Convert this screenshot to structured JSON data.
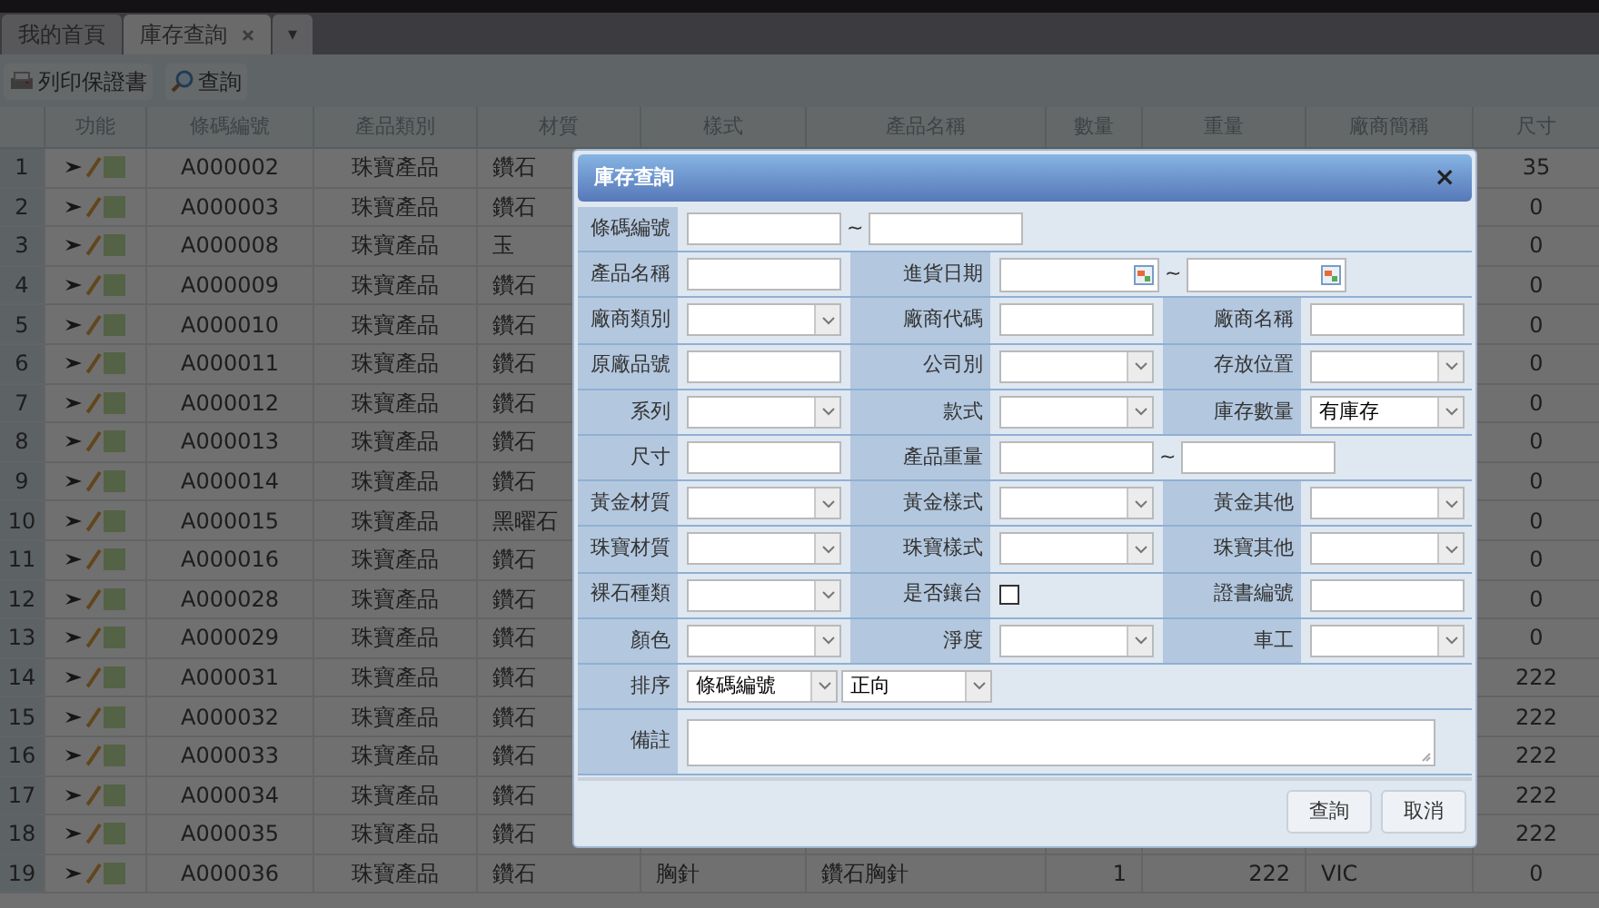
{
  "tabs": [
    {
      "label": "我的首頁",
      "selected": false,
      "closable": false
    },
    {
      "label": "庫存查詢",
      "selected": true,
      "closable": true
    }
  ],
  "tab_menu": "▾",
  "toolbar": [
    {
      "label": "列印保證書",
      "kind": "print"
    },
    {
      "label": "查詢",
      "kind": "search"
    }
  ],
  "table": {
    "columns": [
      "功能",
      "條碼編號",
      "產品類別",
      "材質",
      "樣式",
      "產品名稱",
      "數量",
      "重量",
      "廠商簡稱",
      "尺寸"
    ],
    "rows": [
      {
        "number": "1",
        "barcode": "A000002",
        "category": "珠寶產品",
        "material": "鑽石",
        "size": "35"
      },
      {
        "number": "2",
        "barcode": "A000003",
        "category": "珠寶產品",
        "material": "鑽石",
        "size": "0"
      },
      {
        "number": "3",
        "barcode": "A000008",
        "category": "珠寶產品",
        "material": "玉",
        "size": "0"
      },
      {
        "number": "4",
        "barcode": "A000009",
        "category": "珠寶產品",
        "material": "鑽石",
        "size": "0"
      },
      {
        "number": "5",
        "barcode": "A000010",
        "category": "珠寶產品",
        "material": "鑽石",
        "size": "0"
      },
      {
        "number": "6",
        "barcode": "A000011",
        "category": "珠寶產品",
        "material": "鑽石",
        "size": "0"
      },
      {
        "number": "7",
        "barcode": "A000012",
        "category": "珠寶產品",
        "material": "鑽石",
        "size": "0"
      },
      {
        "number": "8",
        "barcode": "A000013",
        "category": "珠寶產品",
        "material": "鑽石",
        "size": "0"
      },
      {
        "number": "9",
        "barcode": "A000014",
        "category": "珠寶產品",
        "material": "鑽石",
        "size": "0"
      },
      {
        "number": "10",
        "barcode": "A000015",
        "category": "珠寶產品",
        "material": "黑曜石",
        "size": "0"
      },
      {
        "number": "11",
        "barcode": "A000016",
        "category": "珠寶產品",
        "material": "鑽石",
        "size": "0"
      },
      {
        "number": "12",
        "barcode": "A000028",
        "category": "珠寶產品",
        "material": "鑽石",
        "size": "0"
      },
      {
        "number": "13",
        "barcode": "A000029",
        "category": "珠寶產品",
        "material": "鑽石",
        "size": "0"
      },
      {
        "number": "14",
        "barcode": "A000031",
        "category": "珠寶產品",
        "material": "鑽石",
        "size": "222"
      },
      {
        "number": "15",
        "barcode": "A000032",
        "category": "珠寶產品",
        "material": "鑽石",
        "size": "222"
      },
      {
        "number": "16",
        "barcode": "A000033",
        "category": "珠寶產品",
        "material": "鑽石",
        "size": "222"
      },
      {
        "number": "17",
        "barcode": "A000034",
        "category": "珠寶產品",
        "material": "鑽石",
        "size": "222"
      },
      {
        "number": "18",
        "barcode": "A000035",
        "category": "珠寶產品",
        "material": "鑽石",
        "size": "222"
      },
      {
        "number": "19",
        "barcode": "A000036",
        "category": "珠寶產品",
        "material": "鑽石",
        "style": "胸針",
        "name": "鑽石胸針",
        "quantity": "1",
        "weight": "222",
        "vendor": "VIC",
        "size": "0"
      }
    ]
  },
  "dialog": {
    "title": "庫存查詢",
    "close": "×",
    "rows": [
      [
        {
          "label": "條碼編號",
          "kind": "text-range",
          "separator": "~"
        }
      ],
      [
        {
          "label": "產品名稱",
          "kind": "text"
        },
        {
          "label": "進貨日期",
          "kind": "date-range",
          "separator": "~"
        }
      ],
      [
        {
          "label": "廠商類別",
          "kind": "select"
        },
        {
          "label": "廠商代碼",
          "kind": "text"
        },
        {
          "label": "廠商名稱",
          "kind": "text"
        }
      ],
      [
        {
          "label": "原廠品號",
          "kind": "text"
        },
        {
          "label": "公司別",
          "kind": "select"
        },
        {
          "label": "存放位置",
          "kind": "select"
        }
      ],
      [
        {
          "label": "系列",
          "kind": "select"
        },
        {
          "label": "款式",
          "kind": "select"
        },
        {
          "label": "庫存數量",
          "kind": "select",
          "value": "有庫存"
        }
      ],
      [
        {
          "label": "尺寸",
          "kind": "text"
        },
        {
          "label": "產品重量",
          "kind": "text-range",
          "separator": "~"
        }
      ],
      [
        {
          "label": "黃金材質",
          "kind": "select"
        },
        {
          "label": "黃金樣式",
          "kind": "select"
        },
        {
          "label": "黃金其他",
          "kind": "select"
        }
      ],
      [
        {
          "label": "珠寶材質",
          "kind": "select"
        },
        {
          "label": "珠寶樣式",
          "kind": "select"
        },
        {
          "label": "珠寶其他",
          "kind": "select"
        }
      ],
      [
        {
          "label": "裸石種類",
          "kind": "select"
        },
        {
          "label": "是否鑲台",
          "kind": "checkbox",
          "checked": false
        },
        {
          "label": "證書編號",
          "kind": "text"
        }
      ],
      [
        {
          "label": "顏色",
          "kind": "select"
        },
        {
          "label": "淨度",
          "kind": "select"
        },
        {
          "label": "車工",
          "kind": "select"
        }
      ],
      [
        {
          "label": "排序",
          "kind": "select-pair",
          "values": [
            "條碼編號",
            "正向"
          ]
        }
      ],
      [
        {
          "label": "備註",
          "kind": "textarea"
        }
      ]
    ],
    "buttons": [
      "查詢",
      "取消"
    ]
  }
}
